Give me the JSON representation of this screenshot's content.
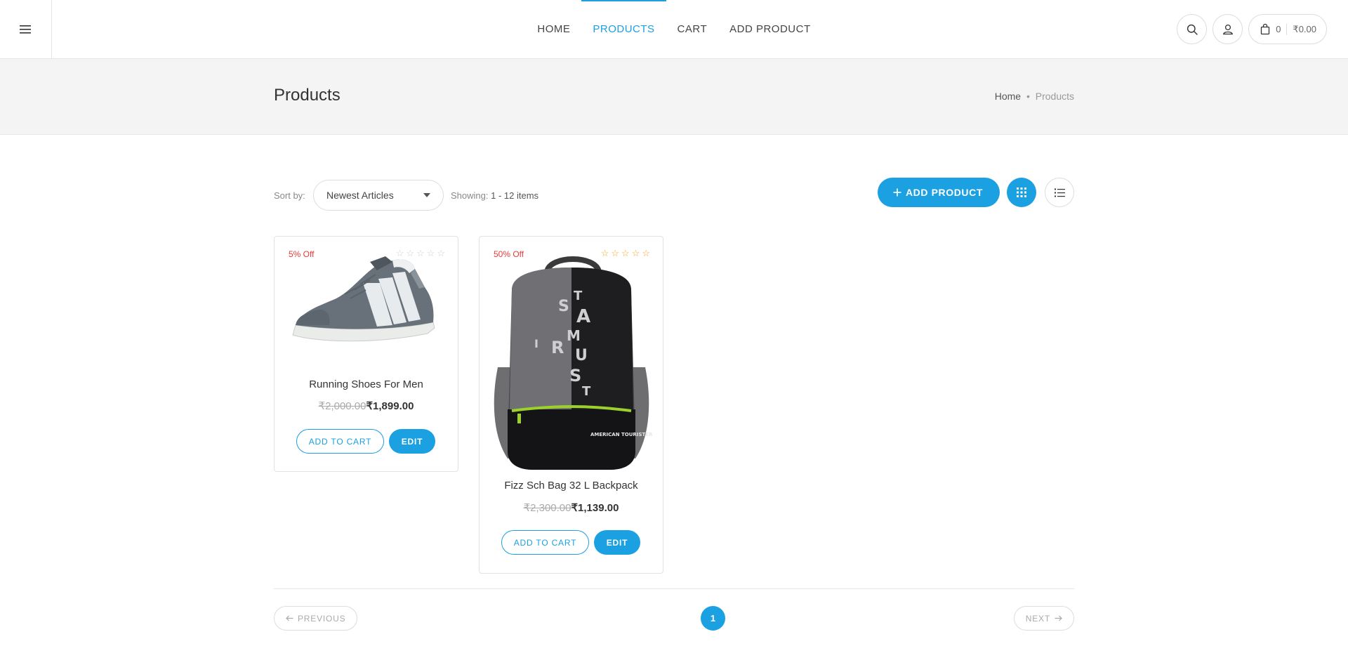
{
  "header": {
    "nav": [
      {
        "label": "HOME",
        "active": false
      },
      {
        "label": "PRODUCTS",
        "active": true
      },
      {
        "label": "CART",
        "active": false
      },
      {
        "label": "ADD PRODUCT",
        "active": false
      }
    ],
    "cart_count": "0",
    "cart_total": "₹0.00",
    "icons": [
      "menu-icon",
      "search-icon",
      "user-icon",
      "shopping-bag-icon"
    ]
  },
  "page": {
    "title": "Products",
    "breadcrumb": {
      "home": "Home",
      "separator": "•",
      "current": "Products"
    }
  },
  "toolbar": {
    "sort_label": "Sort by:",
    "sort_value": "Newest Articles",
    "showing_label": "Showing:",
    "showing_value": "1 - 12 items",
    "add_product_label": "ADD PRODUCT"
  },
  "products": [
    {
      "discount": "5% Off",
      "rating": 0,
      "name": "Running Shoes For Men",
      "old_price": "₹2,000.00",
      "new_price": "₹1,899.00",
      "add_to_cart": "ADD TO CART",
      "edit": "EDIT"
    },
    {
      "discount": "50% Off",
      "rating": 5,
      "name": "Fizz Sch Bag 32 L Backpack",
      "old_price": "₹2,300.00",
      "new_price": "₹1,139.00",
      "add_to_cart": "ADD TO CART",
      "edit": "EDIT",
      "brand_text": "AMERICAN TOURISTER"
    }
  ],
  "pagination": {
    "previous": "PREVIOUS",
    "current": "1",
    "next": "NEXT"
  },
  "colors": {
    "accent": "#1ba0e2",
    "discount": "#e23b3b",
    "star": "#f6a623"
  }
}
